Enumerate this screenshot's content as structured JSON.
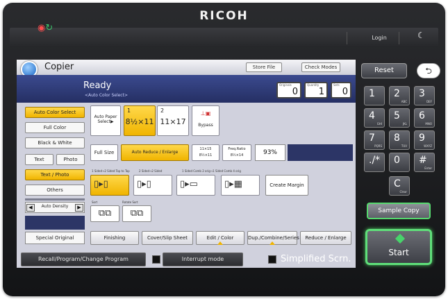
{
  "brand": "RICOH",
  "topbar": {
    "login": "Login",
    "moon_icon": "moon-icon"
  },
  "app": {
    "title": "Copier",
    "store_file": "Store File",
    "check_modes": "Check Modes",
    "status": "Ready",
    "status_sub": "<Auto Color Select>",
    "counters": [
      {
        "label": "Originals",
        "value": "0"
      },
      {
        "label": "Quantity",
        "value": "1"
      },
      {
        "label": "Sets",
        "value": "0"
      }
    ]
  },
  "color_modes": [
    "Auto Color Select",
    "Full Color",
    "Black & White"
  ],
  "original_types": [
    "Text",
    "Photo",
    "Text / Photo",
    "Others"
  ],
  "density": {
    "label": "Auto Density",
    "left": "◀",
    "right": "▶"
  },
  "special_original": "Special Original",
  "paper": {
    "auto_select": "Auto Paper Select▶",
    "tray1_num": "1",
    "tray1_size": "8½×11",
    "tray2_num": "2",
    "tray2_size": "11×17",
    "bypass": "Bypass"
  },
  "ratio": {
    "full_size": "Full Size",
    "auto_reduce": "Auto Reduce / Enlarge",
    "preset1_line1": "11×15",
    "preset1_line2": "8½×11",
    "preset2_line1": "Freq.Ratio",
    "preset2_line2": "8½×14",
    "value": "93%"
  },
  "duplex_labels": [
    "1 Sided→2 Sided Top to Top",
    "2 Sided→2 Sided",
    "1 Sided Comb 2 orig→1 Sided Comb 4 orig"
  ],
  "create_margin": "Create Margin",
  "sort_labels": [
    "Sort",
    "Rotate Sort"
  ],
  "bottom_tabs": [
    "Finishing",
    "Cover/Slip Sheet",
    "Edit / Color",
    "Dup./Combine/Series",
    "Reduce / Enlarge"
  ],
  "bottom_bar": {
    "recall": "Recall/Program/Change Program",
    "interrupt": "Interrupt mode",
    "simplified": "Simplified Scrn."
  },
  "keypad": {
    "reset": "Reset",
    "back_icon": "back-icon",
    "keys": [
      {
        "main": "1",
        "sub": ""
      },
      {
        "main": "2",
        "sub": "ABC"
      },
      {
        "main": "3",
        "sub": "DEF"
      },
      {
        "main": "4",
        "sub": "GHI"
      },
      {
        "main": "5",
        "sub": "JKL"
      },
      {
        "main": "6",
        "sub": "MNO"
      },
      {
        "main": "7",
        "sub": "PQRS"
      },
      {
        "main": "8",
        "sub": "TUV"
      },
      {
        "main": "9",
        "sub": "WXYZ"
      },
      {
        "main": "./*",
        "sub": ""
      },
      {
        "main": "0",
        "sub": ""
      },
      {
        "main": "#",
        "sub": "Enter"
      },
      {
        "main": "C",
        "sub": "Clear"
      }
    ],
    "sample_copy": "Sample Copy",
    "start": "Start"
  },
  "colors": {
    "accent": "#f0b400",
    "start_glow": "#5fe07a",
    "status_bg": "#2c3566"
  }
}
